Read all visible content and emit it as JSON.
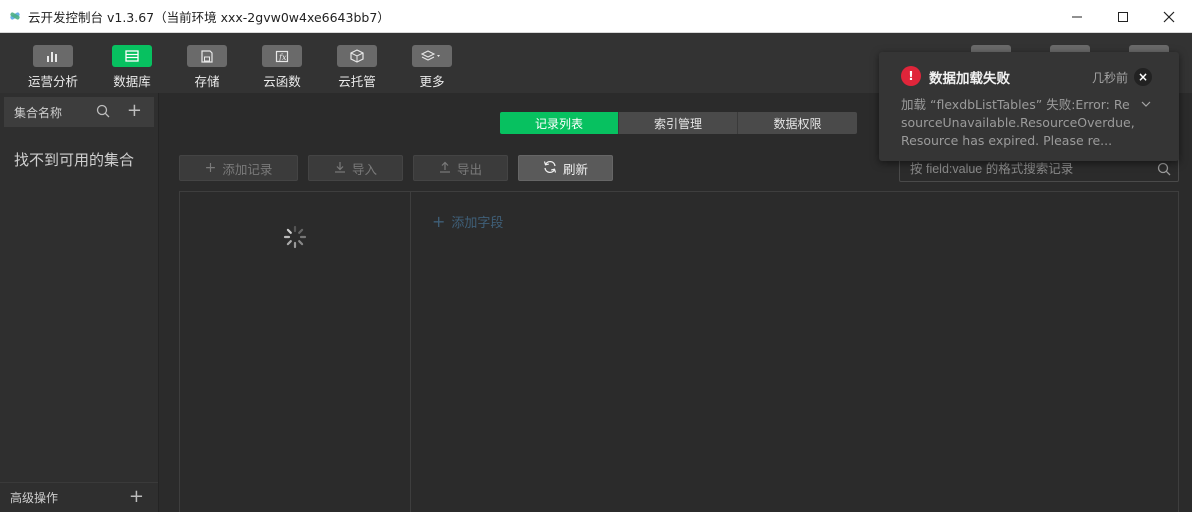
{
  "window": {
    "title": "云开发控制台 v1.3.67（当前环境 xxx-2gvw0w4xe6643bb7）"
  },
  "toolbar": {
    "items": [
      {
        "label": "运营分析",
        "icon": "bar-chart-icon"
      },
      {
        "label": "数据库",
        "icon": "database-icon",
        "active": true
      },
      {
        "label": "存储",
        "icon": "storage-icon"
      },
      {
        "label": "云函数",
        "icon": "function-icon"
      },
      {
        "label": "云托管",
        "icon": "cube-icon"
      },
      {
        "label": "更多",
        "icon": "layers-icon"
      }
    ]
  },
  "sidebar": {
    "title": "集合名称",
    "empty_text": "找不到可用的集合",
    "footer_label": "高级操作"
  },
  "main": {
    "tabs": [
      "记录列表",
      "索引管理",
      "数据权限"
    ],
    "buttons": {
      "add_record": "添加记录",
      "import": "导入",
      "export": "导出",
      "refresh": "刷新"
    },
    "search_placeholder": "按 field:value 的格式搜索记录",
    "add_field": "添加字段"
  },
  "notification": {
    "title": "数据加载失败",
    "time": "几秒前",
    "body": "加载 “flexdbListTables” 失败:Error: ResourceUnavailable.ResourceOverdue, Resource has expired. Please re..."
  },
  "colors": {
    "accent": "#07c160",
    "error": "#e0253a"
  }
}
